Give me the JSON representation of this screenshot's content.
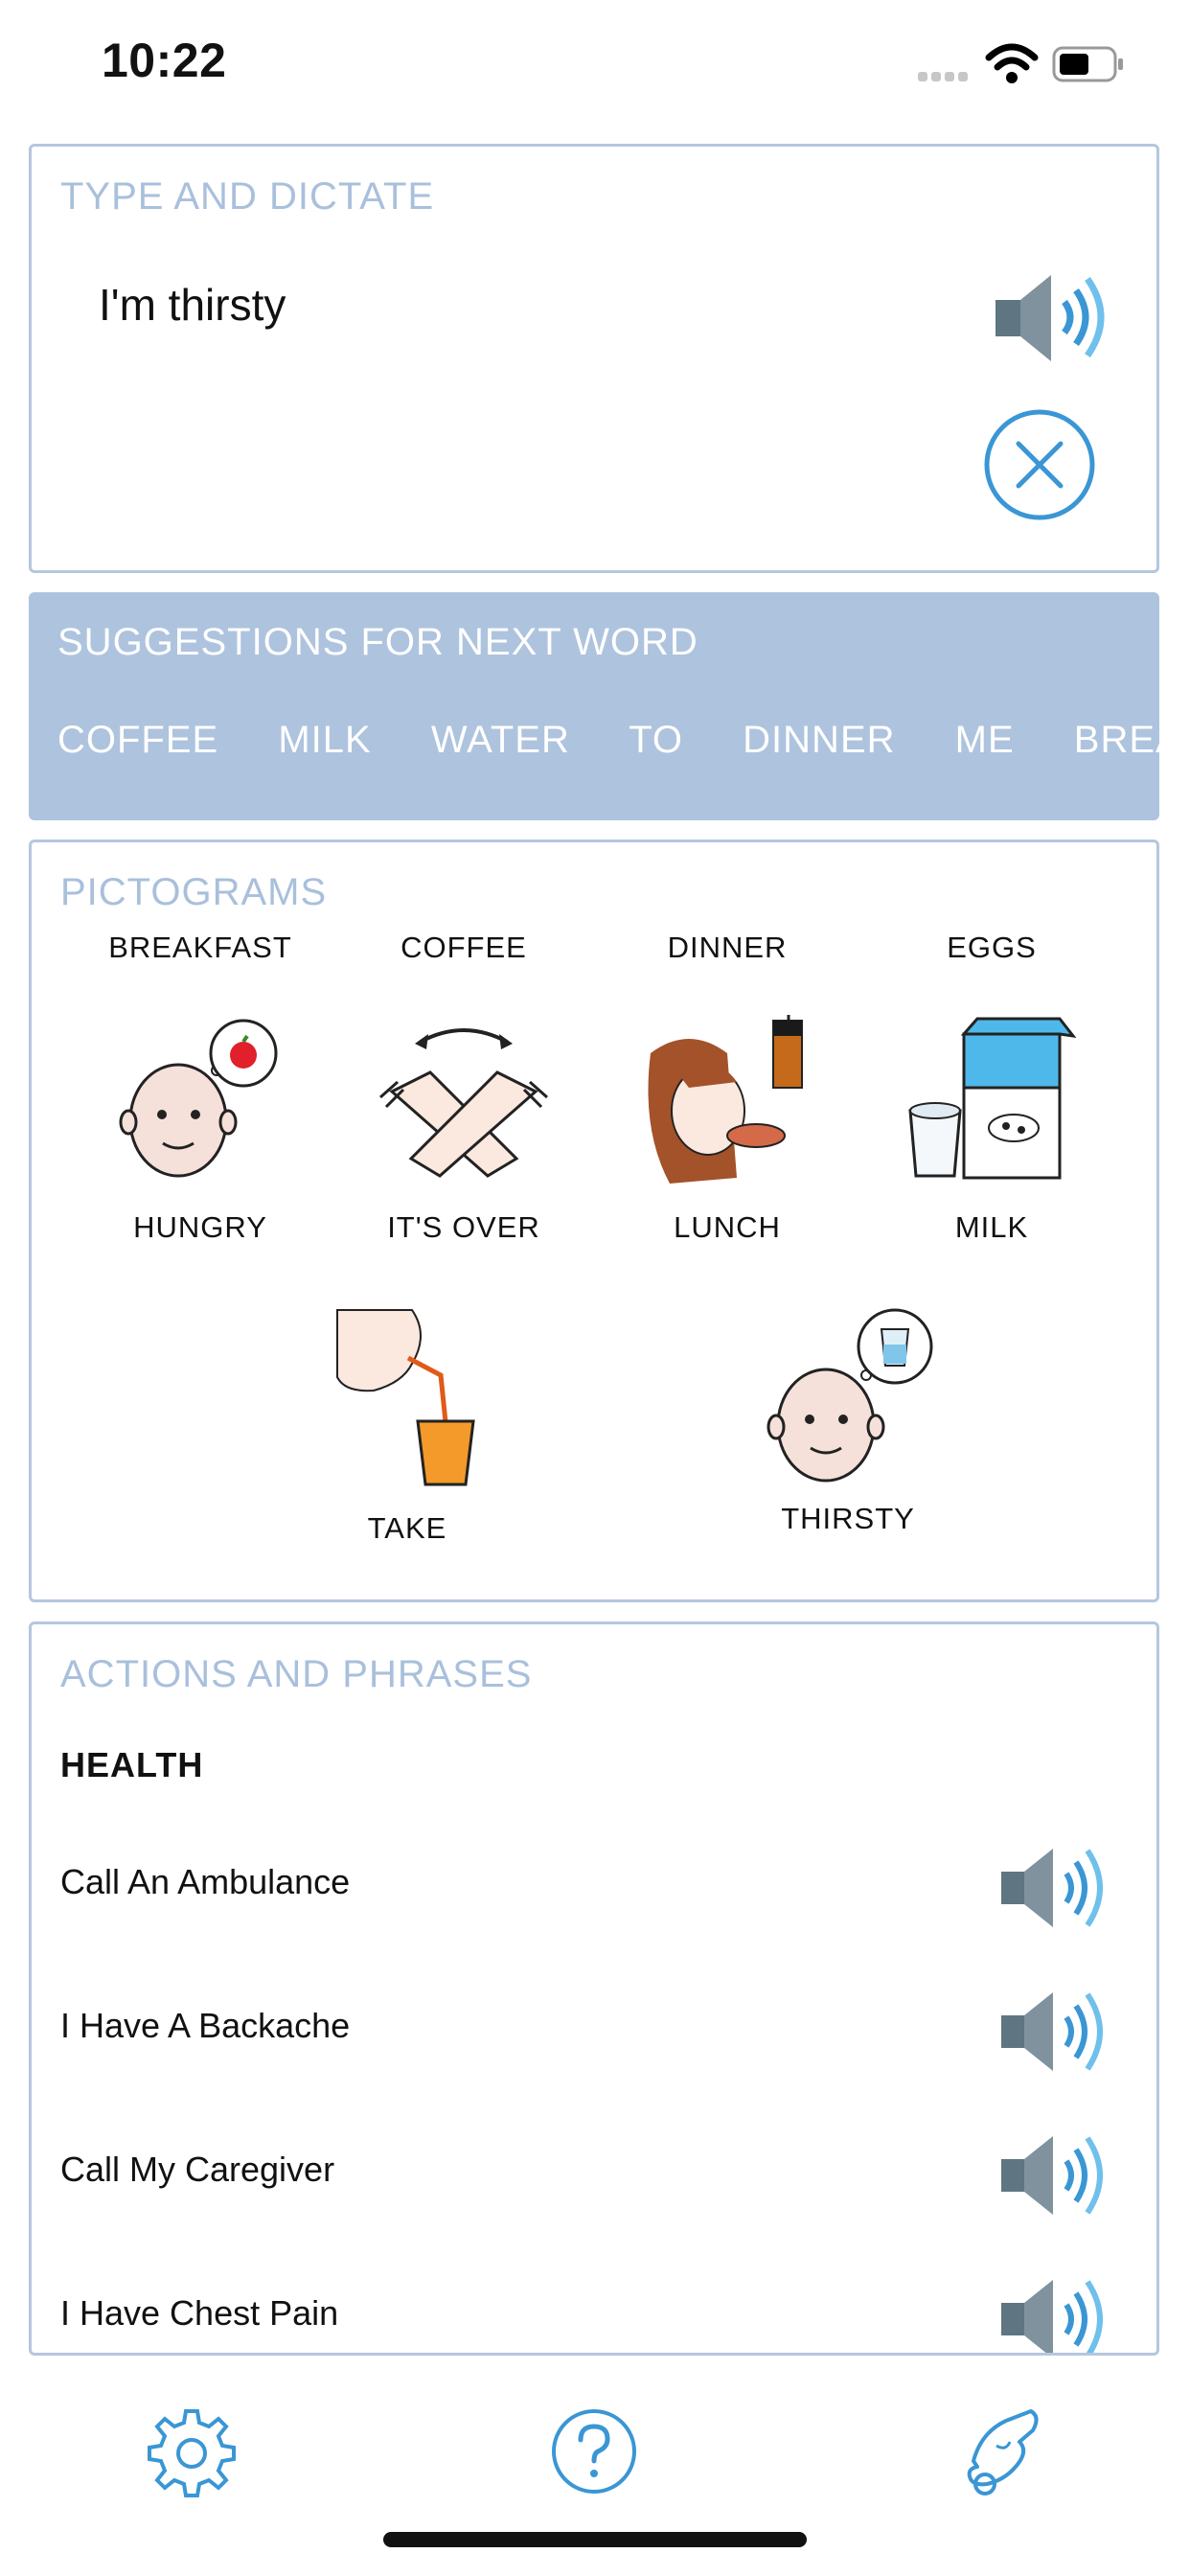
{
  "status_bar": {
    "time": "10:22"
  },
  "type_panel": {
    "title": "TYPE AND DICTATE",
    "text": "I'm thirsty",
    "speak_icon": "speaker-icon",
    "clear_icon": "close-circle-icon"
  },
  "suggestions": {
    "title": "SUGGESTIONS FOR NEXT WORD",
    "words": [
      "COFFEE",
      "MILK",
      "WATER",
      "TO",
      "DINNER",
      "ME",
      "BREAKF."
    ]
  },
  "pictograms": {
    "title": "PICTOGRAMS",
    "items": [
      {
        "label": "BREAKFAST"
      },
      {
        "label": "COFFEE"
      },
      {
        "label": "DINNER"
      },
      {
        "label": "EGGS"
      },
      {
        "label": "HUNGRY"
      },
      {
        "label": "IT'S OVER"
      },
      {
        "label": "LUNCH"
      },
      {
        "label": "MILK"
      },
      {
        "label": "TAKE"
      },
      {
        "label": "THIRSTY"
      }
    ]
  },
  "actions": {
    "title": "ACTIONS AND PHRASES",
    "category": "HEALTH",
    "phrases": [
      {
        "text": "Call An Ambulance"
      },
      {
        "text": "I Have A Backache"
      },
      {
        "text": "Call My Caregiver"
      },
      {
        "text": "I Have Chest Pain"
      }
    ]
  },
  "toolbar": {
    "icons": [
      "gear-icon",
      "help-icon",
      "hand-icon"
    ]
  },
  "colors": {
    "accent": "#3a96d4",
    "panel_border": "#b4c7de",
    "suggest_bg": "#aec3de",
    "title_light": "#a9c0dc"
  }
}
